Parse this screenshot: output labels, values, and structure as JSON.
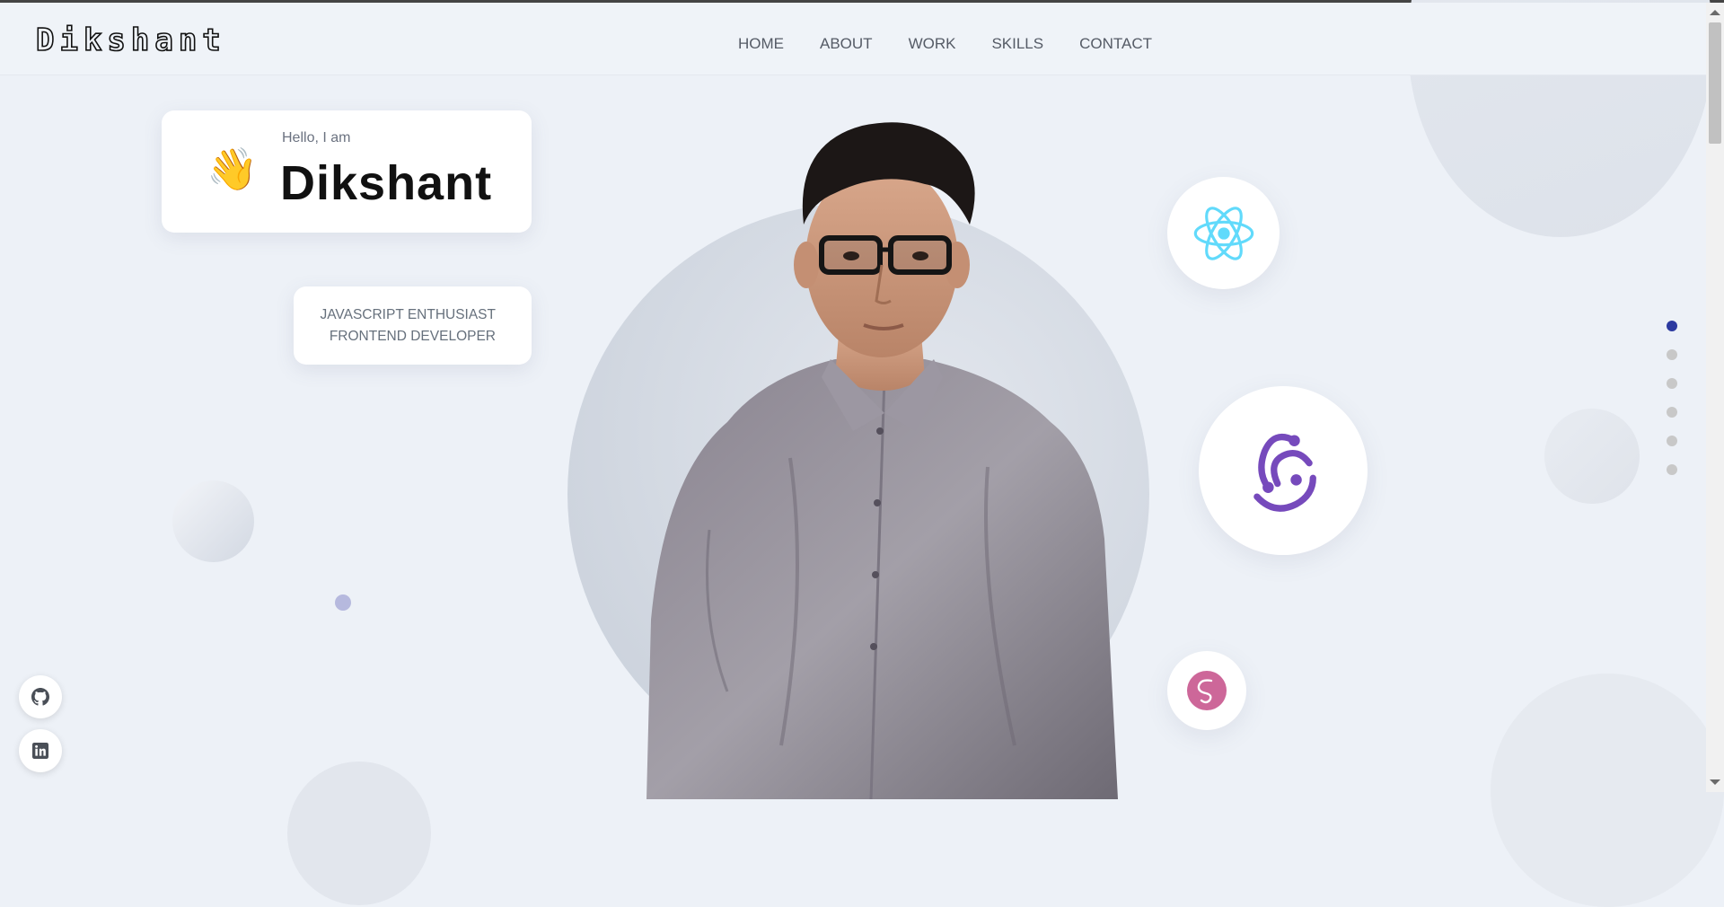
{
  "header": {
    "logo": "Dikshant",
    "nav": [
      "HOME",
      "ABOUT",
      "WORK",
      "SKILLS",
      "CONTACT"
    ]
  },
  "hero": {
    "greeting": "Hello, I am",
    "name": "Dikshant",
    "roles": [
      "JAVASCRIPT ENTHUSIAST",
      "FRONTEND DEVELOPER"
    ],
    "wave_icon": "waving-hand-icon",
    "skill_icons": [
      "react-icon",
      "redux-icon",
      "sass-icon"
    ]
  },
  "section_dots": {
    "count": 6,
    "active_index": 0
  },
  "social": [
    "github-icon",
    "linkedin-icon"
  ],
  "colors": {
    "background": "#edf1f7",
    "accent_dot": "#2c3aa0",
    "react": "#61dafb",
    "redux": "#764abc",
    "sass": "#cd6799"
  }
}
